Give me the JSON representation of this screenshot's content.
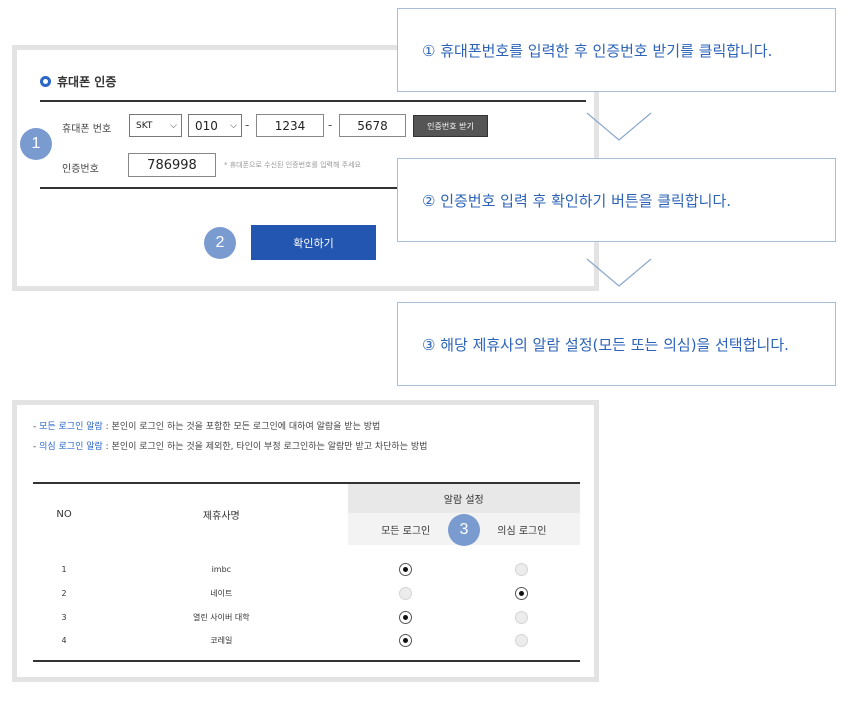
{
  "callouts": {
    "step1": "① 휴대폰번호를 입력한 후 인증번호 받기를 클릭합니다.",
    "step2": "② 인증번호 입력 후 확인하기 버튼을 클릭합니다.",
    "step3": "③ 해당 제휴사의 알람 설정(모든 또는 의심)을 선택합니다."
  },
  "steps": [
    "1",
    "2",
    "3"
  ],
  "verify": {
    "title": "휴대폰 인증",
    "phone_label": "휴대폰 번호",
    "carrier": "SKT",
    "prefix": "010",
    "middle": "1234",
    "last": "5678",
    "dash": "-",
    "request_button": "인증번호 받기",
    "code_label": "인증번호",
    "code_value": "786998",
    "code_hint": "* 휴대폰으로 수신된 인증번호를 입력해 주세요",
    "confirm_button": "확인하기"
  },
  "alarm": {
    "desc1_prefix": "- ",
    "desc1_key": "모든 로그인 알람",
    "desc1_text": " : 본인이 로그인 하는 것을 포함한 모든 로그인에 대하여 알람을 받는 방법",
    "desc2_prefix": "- ",
    "desc2_key": "의심 로그인 알람",
    "desc2_text": " : 본인이 로그인 하는 것을 제외한, 타인이 부정 로그인하는 알람만 받고 차단하는 방법",
    "headers": {
      "no": "NO",
      "name": "제휴사명",
      "setting": "알람 설정",
      "all": "모든 로그인",
      "suspicious": "의심 로그인"
    },
    "rows": [
      {
        "no": "1",
        "name": "imbc",
        "selected": "all"
      },
      {
        "no": "2",
        "name": "네이트",
        "selected": "suspicious"
      },
      {
        "no": "3",
        "name": "열린 사이버 대학",
        "selected": "all"
      },
      {
        "no": "4",
        "name": "코레일",
        "selected": "all"
      }
    ]
  },
  "colors": {
    "accent": "#2a66c8",
    "confirm_button": "#2356b0",
    "step_badge": "#7a9bd0"
  }
}
